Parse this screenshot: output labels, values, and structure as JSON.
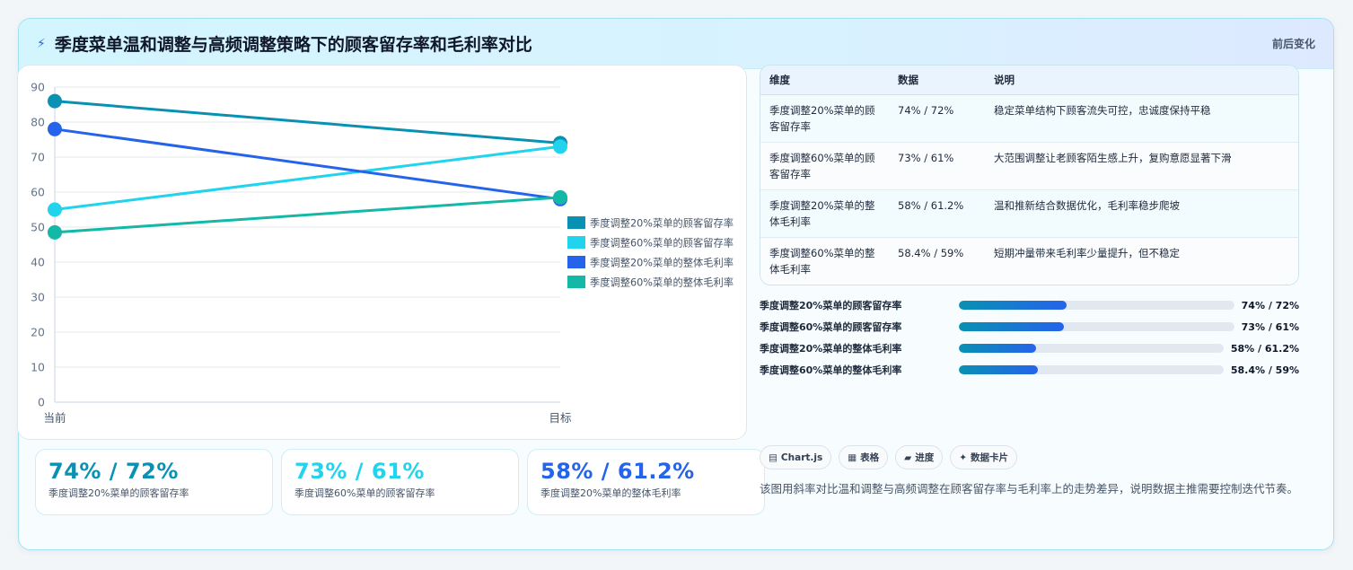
{
  "header": {
    "title": "季度菜单温和调整与高频调整策略下的顾客留存率和毛利率对比",
    "right_label": "前后变化",
    "icon": "lightning-icon"
  },
  "chart_data": {
    "type": "line",
    "categories": [
      "当前",
      "目标"
    ],
    "ylim": [
      0,
      90
    ],
    "yticks": [
      0,
      10,
      20,
      30,
      40,
      50,
      60,
      70,
      80,
      90
    ],
    "grid": true,
    "legend_position": "right",
    "series": [
      {
        "name": "季度调整20%菜单的顾客留存率",
        "values": [
          86,
          74
        ],
        "color": "#0891b2"
      },
      {
        "name": "季度调整60%菜单的顾客留存率",
        "values": [
          55,
          73
        ],
        "color": "#22d3ee"
      },
      {
        "name": "季度调整20%菜单的整体毛利率",
        "values": [
          78,
          58
        ],
        "color": "#2563eb"
      },
      {
        "name": "季度调整60%菜单的整体毛利率",
        "values": [
          48.5,
          58.5
        ],
        "color": "#14b8a6"
      }
    ]
  },
  "legend_items": [
    {
      "label": "季度调整20%菜单的顾客留存率",
      "color": "#0891b2"
    },
    {
      "label": "季度调整60%菜单的顾客留存率",
      "color": "#22d3ee"
    },
    {
      "label": "季度调整20%菜单的整体毛利率",
      "color": "#2563eb"
    },
    {
      "label": "季度调整60%菜单的整体毛利率",
      "color": "#14b8a6"
    }
  ],
  "kpis": [
    {
      "value": "74% / 72%",
      "label": "季度调整20%菜单的顾客留存率",
      "color": "#0891b2"
    },
    {
      "value": "73% / 61%",
      "label": "季度调整60%菜单的顾客留存率",
      "color": "#22d3ee"
    },
    {
      "value": "58% / 61.2%",
      "label": "季度调整20%菜单的整体毛利率",
      "color": "#2563eb"
    }
  ],
  "table": {
    "headers": [
      "维度",
      "数据",
      "说明"
    ],
    "rows": [
      [
        "季度调整20%菜单的顾客留存率",
        "74% / 72%",
        "稳定菜单结构下顾客流失可控，忠诚度保持平稳"
      ],
      [
        "季度调整60%菜单的顾客留存率",
        "73% / 61%",
        "大范围调整让老顾客陌生感上升，复购意愿显著下滑"
      ],
      [
        "季度调整20%菜单的整体毛利率",
        "58% / 61.2%",
        "温和推新结合数据优化，毛利率稳步爬坡"
      ],
      [
        "季度调整60%菜单的整体毛利率",
        "58.4% / 59%",
        "短期冲量带来毛利率少量提升，但不稳定"
      ]
    ]
  },
  "progress": [
    {
      "label": "季度调整20%菜单的顾客留存率",
      "value": "74% / 72%",
      "fill": 0.39
    },
    {
      "label": "季度调整60%菜单的顾客留存率",
      "value": "73% / 61%",
      "fill": 0.38
    },
    {
      "label": "季度调整20%菜单的整体毛利率",
      "value": "58% / 61.2%",
      "fill": 0.29
    },
    {
      "label": "季度调整60%菜单的整体毛利率",
      "value": "58.4% / 59%",
      "fill": 0.3
    }
  ],
  "tags": [
    {
      "icon": "▤",
      "label": "Chart.js"
    },
    {
      "icon": "▦",
      "label": "表格"
    },
    {
      "icon": "▰",
      "label": "进度"
    },
    {
      "icon": "✦",
      "label": "数据卡片"
    }
  ],
  "description": "该图用斜率对比温和调整与高频调整在顾客留存率与毛利率上的走势差异，说明数据主推需要控制迭代节奏。"
}
